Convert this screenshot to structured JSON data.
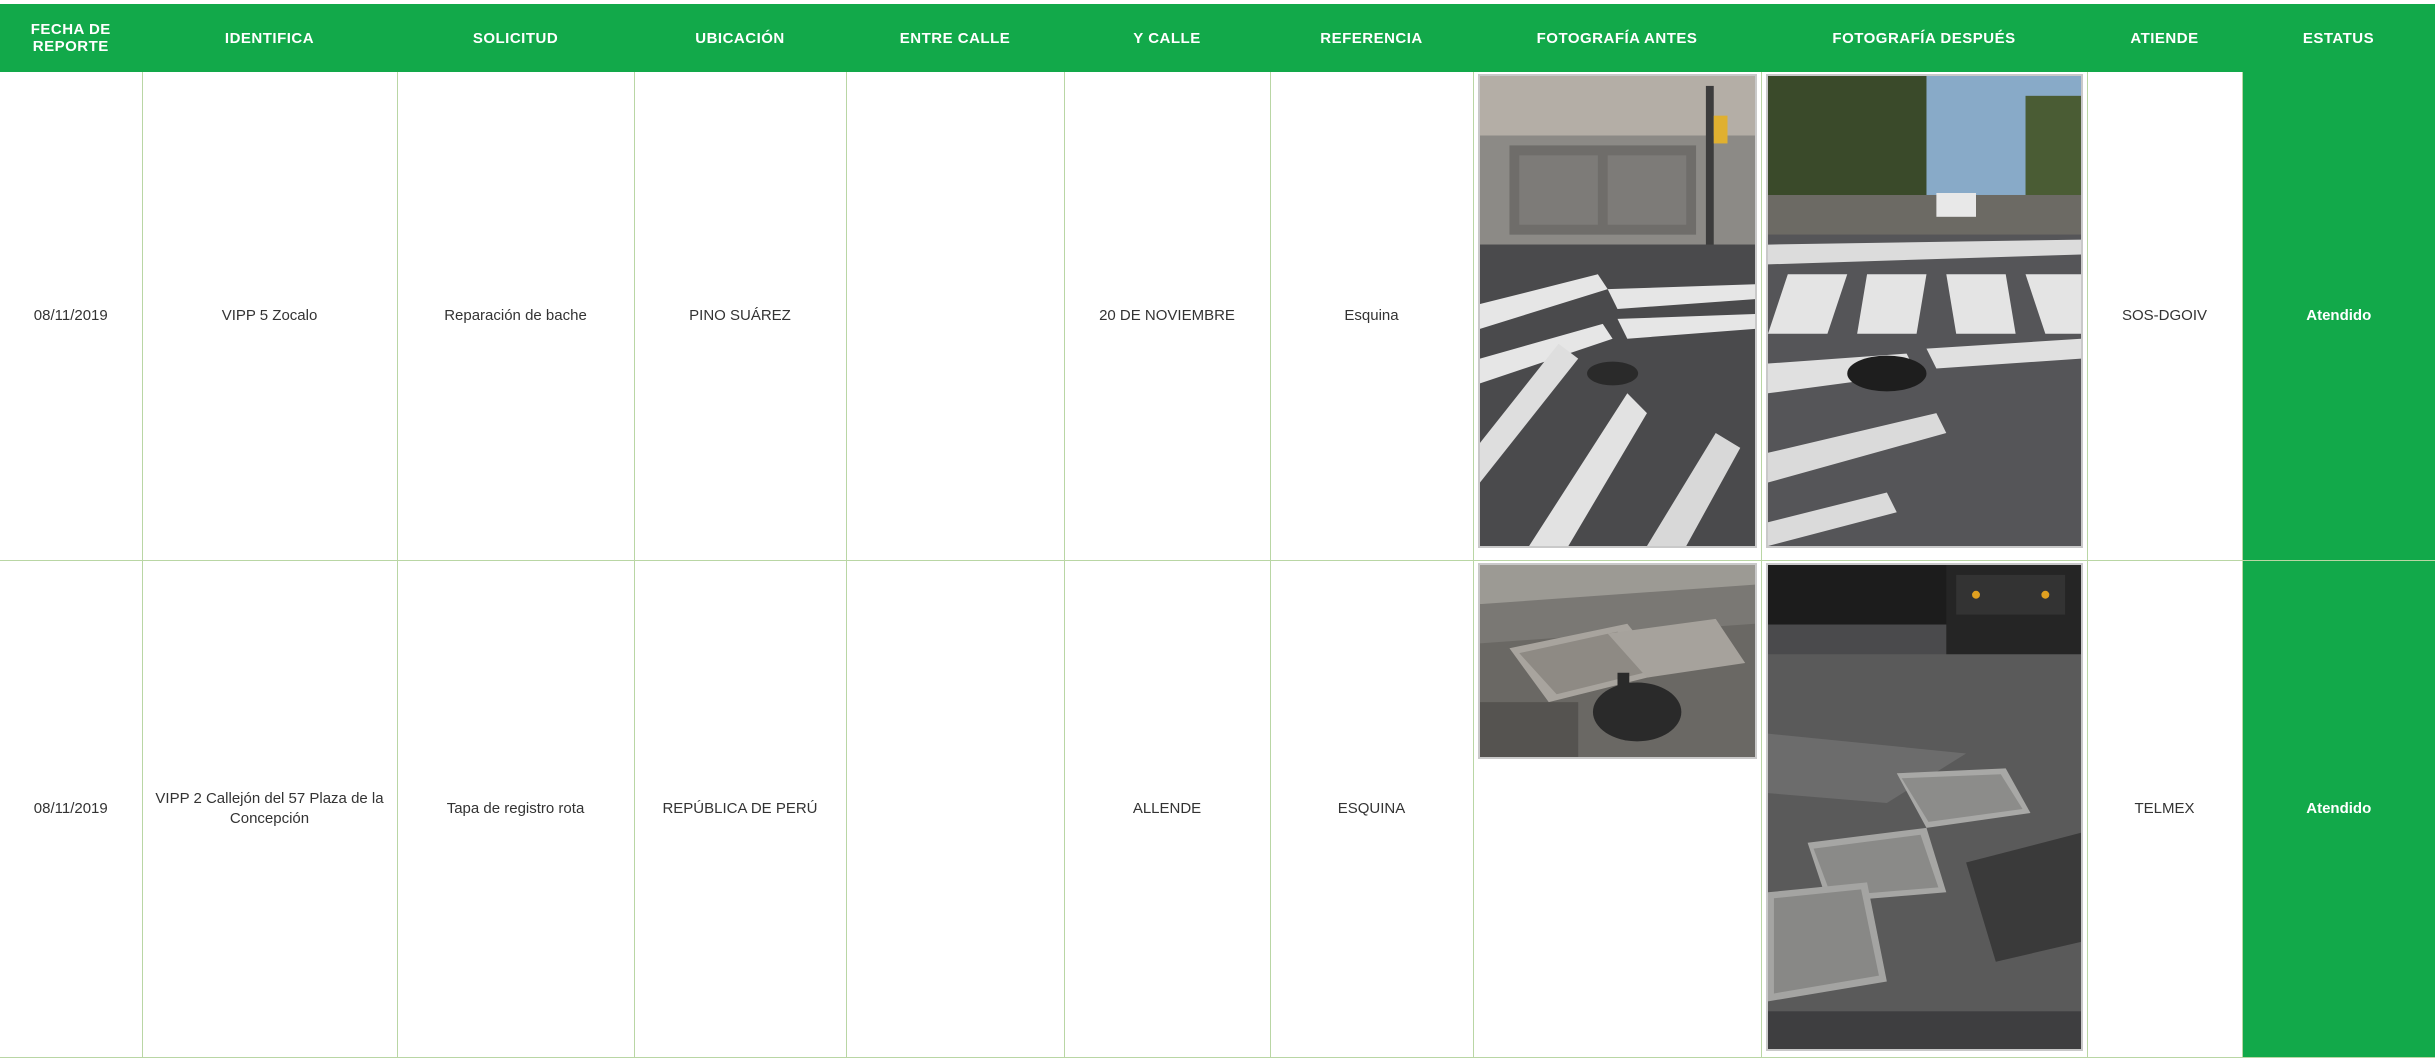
{
  "headers": {
    "fecha": "FECHA DE REPORTE",
    "identifica": "IDENTIFICA",
    "solicitud": "SOLICITUD",
    "ubicacion": "UBICACIÓN",
    "entre_calle": "ENTRE CALLE",
    "y_calle": "Y CALLE",
    "referencia": "REFERENCIA",
    "foto_antes": "FOTOGRAFÍA ANTES",
    "foto_despues": "FOTOGRAFÍA DESPUÉS",
    "atiende": "ATIENDE",
    "estatus": "ESTATUS"
  },
  "rows": [
    {
      "fecha": "08/11/2019",
      "identifica": "VIPP 5 Zocalo",
      "solicitud": "Reparación de bache",
      "ubicacion": "PINO SUÁREZ",
      "entre_calle": "",
      "y_calle": "20 DE NOVIEMBRE",
      "referencia": "Esquina",
      "atiende": "SOS-DGOIV",
      "estatus": "Atendido"
    },
    {
      "fecha": "08/11/2019",
      "identifica": "VIPP 2 Callejón del 57 Plaza de la Concepción",
      "solicitud": "Tapa de registro rota",
      "ubicacion": "REPÚBLICA DE PERÚ",
      "entre_calle": "",
      "y_calle": "ALLENDE",
      "referencia": "ESQUINA",
      "atiende": "TELMEX",
      "estatus": "Atendido"
    }
  ],
  "colors": {
    "header_bg": "#12a94a",
    "status_bg": "#12a94a",
    "grid_line": "#b9d6a4"
  }
}
